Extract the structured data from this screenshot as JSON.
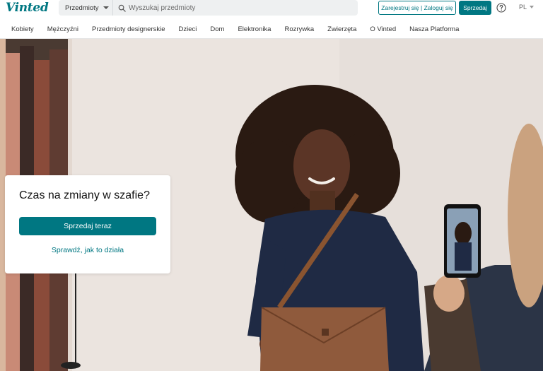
{
  "header": {
    "logo": "Vinted",
    "category_select": "Przedmioty",
    "search_placeholder": "Wyszukaj przedmioty",
    "auth_button": "Zarejestruj się | Zaloguj się",
    "sell_button": "Sprzedaj",
    "language": "PL"
  },
  "nav": {
    "items": [
      {
        "label": "Kobiety"
      },
      {
        "label": "Mężczyźni"
      },
      {
        "label": "Przedmioty designerskie"
      },
      {
        "label": "Dzieci"
      },
      {
        "label": "Dom"
      },
      {
        "label": "Elektronika"
      },
      {
        "label": "Rozrywka"
      },
      {
        "label": "Zwierzęta"
      },
      {
        "label": "O Vinted"
      },
      {
        "label": "Nasza Platforma"
      }
    ]
  },
  "hero": {
    "card_title": "Czas na zmiany w szafie?",
    "card_button": "Sprzedaj teraz",
    "card_link": "Sprawdź, jak to działa"
  },
  "colors": {
    "brand": "#007782",
    "search_bg": "#eef0f1"
  },
  "icons": [
    "search-icon",
    "help-icon",
    "chevron-down-icon"
  ]
}
